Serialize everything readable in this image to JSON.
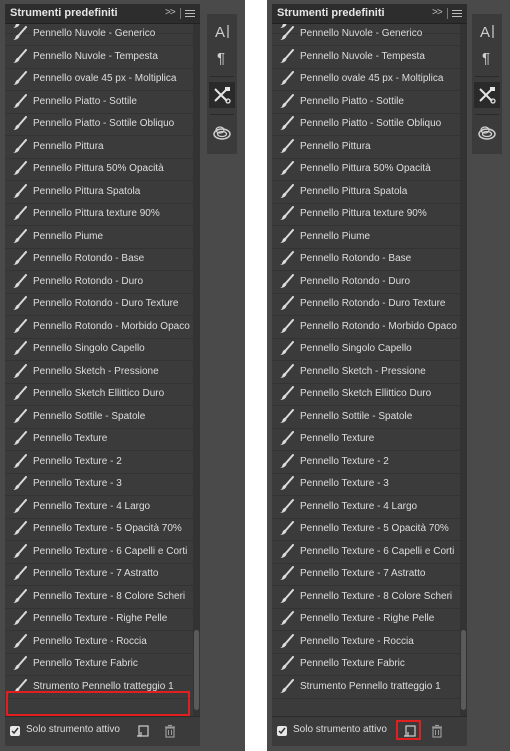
{
  "panel": {
    "title": "Strumenti predefiniti",
    "collapse_icon": "double-chevron-right-icon",
    "menu_icon": "panel-menu-icon"
  },
  "items": [
    "Pennello Nuvole - Generico",
    "Pennello Nuvole - Tempesta",
    "Pennello ovale 45 px - Moltiplica",
    "Pennello Piatto - Sottile",
    "Pennello Piatto - Sottile Obliquo",
    "Pennello Pittura",
    "Pennello Pittura 50% Opacità",
    "Pennello Pittura Spatola",
    "Pennello Pittura texture 90%",
    "Pennello Piume",
    "Pennello Rotondo - Base",
    "Pennello Rotondo - Duro",
    "Pennello Rotondo - Duro Texture",
    "Pennello Rotondo - Morbido Opaco",
    "Pennello Singolo Capello",
    "Pennello Sketch - Pressione",
    "Pennello Sketch Ellittico Duro",
    "Pennello Sottile - Spatole",
    "Pennello Texture",
    "Pennello Texture - 2",
    "Pennello Texture - 3",
    "Pennello Texture - 4 Largo",
    "Pennello Texture - 5 Opacità 70%",
    "Pennello Texture - 6 Capelli e Corti",
    "Pennello Texture - 7 Astratto",
    "Pennello Texture - 8 Colore Scheri",
    "Pennello Texture - Righe Pelle",
    "Pennello Texture - Roccia",
    "Pennello Texture Fabric",
    "Strumento Pennello tratteggio 1"
  ],
  "footer": {
    "checkbox_label": "Solo strumento attivo",
    "checkbox_checked": true,
    "new_icon": "new-preset-icon",
    "trash_icon": "trash-icon"
  },
  "toolstrip": {
    "items": [
      "character-icon",
      "paragraph-icon",
      "tool-presets-icon",
      "libraries-icon"
    ],
    "active": "tool-presets-icon"
  },
  "colors": {
    "panel_bg": "#3b3b3b",
    "header_bg": "#2d2d2d",
    "text": "#dedede",
    "highlight": "#e02020"
  }
}
